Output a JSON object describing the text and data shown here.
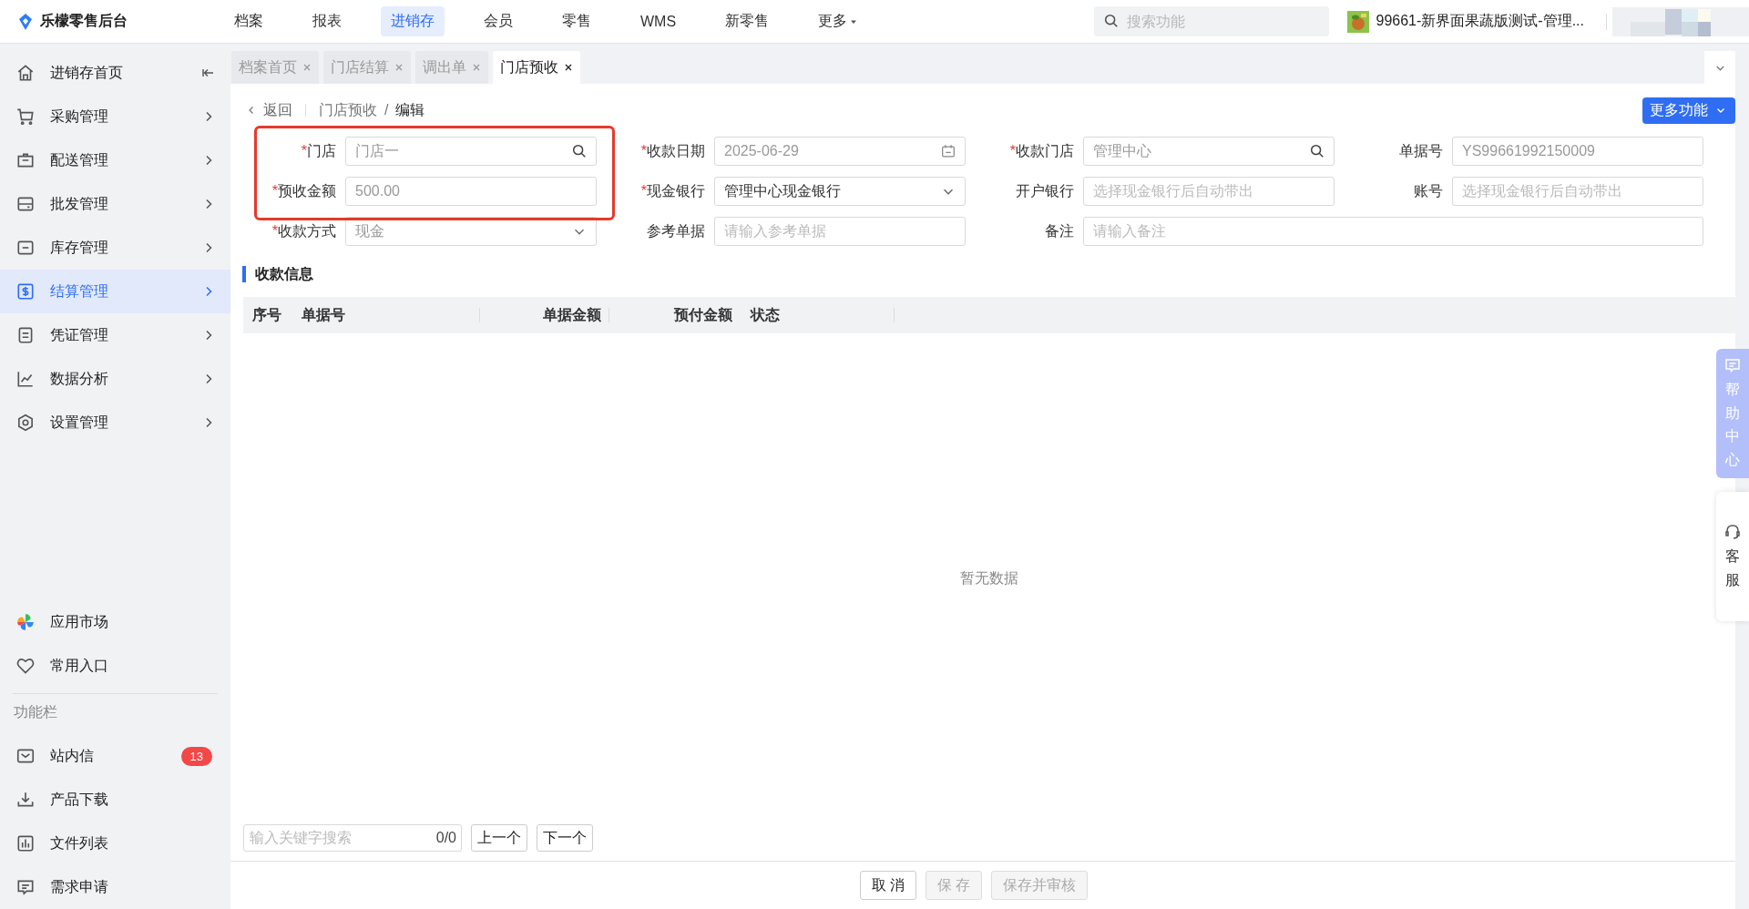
{
  "brand": "乐檬零售后台",
  "top_nav": [
    {
      "label": "档案",
      "selected": false
    },
    {
      "label": "报表",
      "selected": false
    },
    {
      "label": "进销存",
      "selected": true
    },
    {
      "label": "会员",
      "selected": false
    },
    {
      "label": "零售",
      "selected": false
    },
    {
      "label": "WMS",
      "selected": false
    },
    {
      "label": "新零售",
      "selected": false
    },
    {
      "label": "更多",
      "selected": false,
      "dropdown": true
    }
  ],
  "search": {
    "placeholder": "搜索功能"
  },
  "store": {
    "name": "99661-新界面果蔬版测试-管理..."
  },
  "sidebar": {
    "items": [
      {
        "label": "进销存首页",
        "selected": false
      },
      {
        "label": "采购管理",
        "selected": false
      },
      {
        "label": "配送管理",
        "selected": false
      },
      {
        "label": "批发管理",
        "selected": false
      },
      {
        "label": "库存管理",
        "selected": false
      },
      {
        "label": "结算管理",
        "selected": true
      },
      {
        "label": "凭证管理",
        "selected": false
      },
      {
        "label": "数据分析",
        "selected": false
      },
      {
        "label": "设置管理",
        "selected": false
      }
    ],
    "shortcuts": [
      {
        "label": "应用市场"
      },
      {
        "label": "常用入口"
      }
    ],
    "section_label": "功能栏",
    "tools": [
      {
        "label": "站内信",
        "badge": "13"
      },
      {
        "label": "产品下载"
      },
      {
        "label": "文件列表"
      },
      {
        "label": "需求申请"
      }
    ]
  },
  "tabs": [
    {
      "label": "档案首页",
      "selected": false
    },
    {
      "label": "门店结算",
      "selected": false
    },
    {
      "label": "调出单",
      "selected": false
    },
    {
      "label": "门店预收",
      "selected": true
    }
  ],
  "breadcrumb": {
    "back": "返回",
    "parent": "门店预收",
    "separator": "/",
    "current": "编辑"
  },
  "more_button": "更多功能",
  "form": [
    {
      "required_mark": "*",
      "label": "门店",
      "kind": "search",
      "value": "门店一",
      "disabled": true
    },
    {
      "required_mark": "*",
      "label": "收款日期",
      "kind": "date",
      "value": "2025-06-29",
      "disabled": true
    },
    {
      "required_mark": "*",
      "label": "收款门店",
      "kind": "search",
      "value": "管理中心",
      "disabled": true
    },
    {
      "label": "单据号",
      "kind": "text",
      "value": "YS99661992150009",
      "disabled": true
    },
    {
      "required_mark": "*",
      "label": "预收金额",
      "kind": "text",
      "value": "500.00",
      "disabled": true
    },
    {
      "required_mark": "*",
      "label": "现金银行",
      "kind": "select",
      "value": "管理中心现金银行",
      "disabled": false
    },
    {
      "label": "开户银行",
      "kind": "text",
      "placeholder": "选择现金银行后自动带出"
    },
    {
      "label": "账号",
      "kind": "text",
      "placeholder": "选择现金银行后自动带出"
    },
    {
      "required_mark": "*",
      "label": "收款方式",
      "kind": "select",
      "value": "现金",
      "disabled": true
    },
    {
      "label": "参考单据",
      "kind": "text",
      "placeholder": "请输入参考单据"
    },
    {
      "label": "备注",
      "kind": "wide",
      "placeholder": "请输入备注"
    }
  ],
  "section_title": "收款信息",
  "table": {
    "columns": [
      "序号",
      "单据号",
      "单据金额",
      "预付金额",
      "状态"
    ],
    "empty_text": "暂无数据"
  },
  "find_bar": {
    "placeholder": "输入关键字搜索",
    "count": "0/0",
    "prev": "上一个",
    "next": "下一个"
  },
  "footer_buttons": [
    {
      "label": "取 消",
      "disabled": false
    },
    {
      "label": "保 存",
      "disabled": true
    },
    {
      "label": "保存并审核",
      "disabled": true
    }
  ],
  "float_tabs": [
    {
      "label": "帮助中心",
      "kind": "help"
    },
    {
      "label": "客服",
      "kind": "service"
    }
  ]
}
